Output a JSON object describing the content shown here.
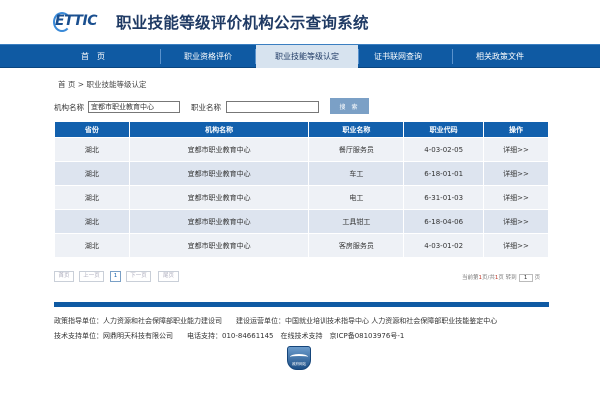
{
  "header": {
    "logo_text": "ETTIC",
    "title": "职业技能等级评价机构公示查询系统"
  },
  "nav": {
    "items": [
      {
        "label": "首　页"
      },
      {
        "label": "职业资格评价"
      },
      {
        "label": "职业技能等级认定"
      },
      {
        "label": "证书联网查询"
      },
      {
        "label": "相关政策文件"
      }
    ],
    "active_index": 2
  },
  "breadcrumb": {
    "home": "首 页",
    "sep": ">",
    "current": "职业技能等级认定"
  },
  "search": {
    "org_label": "机构名称",
    "org_value": "宜都市职业教育中心",
    "occ_label": "职业名称",
    "occ_value": "",
    "button_label": "搜 索"
  },
  "table": {
    "headers": [
      "省份",
      "机构名称",
      "职业名称",
      "职业代码",
      "操作"
    ],
    "rows": [
      [
        "湖北",
        "宜都市职业教育中心",
        "餐厅服务员",
        "4-03-02-05",
        "详细>>"
      ],
      [
        "湖北",
        "宜都市职业教育中心",
        "车工",
        "6-18-01-01",
        "详细>>"
      ],
      [
        "湖北",
        "宜都市职业教育中心",
        "电工",
        "6-31-01-03",
        "详细>>"
      ],
      [
        "湖北",
        "宜都市职业教育中心",
        "工具钳工",
        "6-18-04-06",
        "详细>>"
      ],
      [
        "湖北",
        "宜都市职业教育中心",
        "客房服务员",
        "4-03-01-02",
        "详细>>"
      ]
    ]
  },
  "pager": {
    "first": "首页",
    "prev": "上一页",
    "current": "1",
    "next": "下一页",
    "last": "尾页",
    "info_prefix": "当前第",
    "page_num": "1",
    "info_mid": "页/共",
    "total_pages": "1",
    "info_suffix": "页 转到",
    "jump_value": "1",
    "jump_suffix": "页"
  },
  "footer": {
    "line1": "政策指导单位：人力资源和社会保障部职业能力建设司　　建设运营单位：中国就业培训技术指导中心 人力资源和社会保障部职业技能鉴定中心",
    "line2": "技术支持单位：网鼎明天科技有限公司　　电话支持：010-84661145　在线技术支持　京ICP备08103976号-1",
    "badge_text": "政府网站"
  },
  "colors": {
    "nav_bg": "#0f5aa3",
    "table_header_bg": "#1260ad",
    "title_color": "#1f3a64"
  }
}
